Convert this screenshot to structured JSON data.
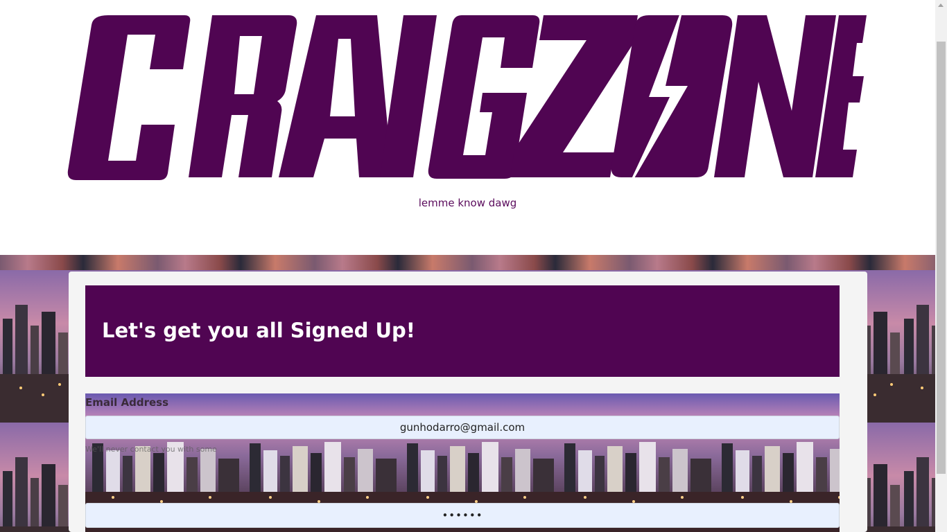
{
  "header": {
    "logo_text": "CRAIGZONE",
    "tagline": "lemme know dawg"
  },
  "jumbotron": {
    "title": "Let's get you all Signed Up!"
  },
  "form": {
    "email_label": "Email Address",
    "email_value": "gunhodarro@gmail.com",
    "help_text": "We'll never contact you with some",
    "password_value": "••••••"
  },
  "colors": {
    "brand_purple": "#500552",
    "tagline": "#5a0b5c",
    "card_bg": "#f4f4f4",
    "autofill_bg": "#e8f0fe"
  },
  "icons": {
    "scroll_up": "chevron-up-icon"
  }
}
